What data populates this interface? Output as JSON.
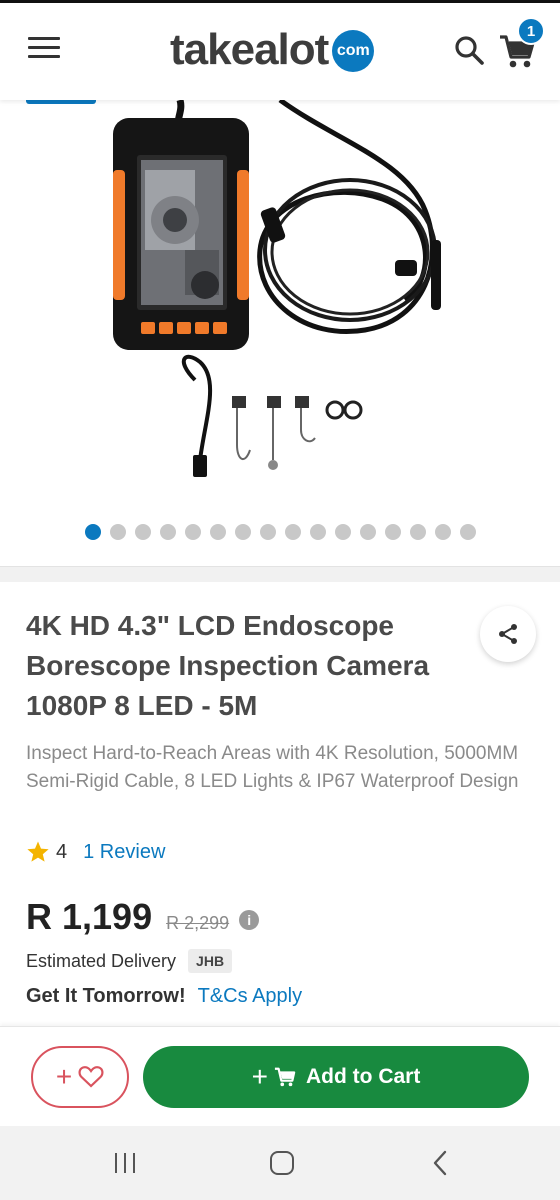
{
  "header": {
    "logo_text": "takealot",
    "logo_badge": ".com",
    "cart_count": "1",
    "icons": [
      "hamburger-menu-icon",
      "search-icon",
      "cart-icon"
    ]
  },
  "gallery": {
    "image_count": 16,
    "active_index": 0
  },
  "product": {
    "title": "4K HD 4.3\" LCD Endoscope Borescope Inspection Camera 1080P 8 LED - 5M",
    "subtitle": "Inspect Hard-to-Reach Areas with 4K Resolution, 5000MM Semi-Rigid Cable, 8 LED Lights & IP67 Waterproof Design",
    "rating": "4",
    "reviews_label": "1 Review",
    "price": "R 1,199",
    "old_price": "R 2,299",
    "delivery_label": "Estimated Delivery",
    "delivery_region": "JHB",
    "delivery_time": "Get It Tomorrow!",
    "terms_link": "T&Cs Apply"
  },
  "actions": {
    "wishlist_label": "+",
    "add_to_cart_label": "Add to Cart"
  },
  "colors": {
    "brand_blue": "#0b79bf",
    "cart_green": "#188a3f",
    "wishlist_red": "#d9535e",
    "star_gold": "#f4b400"
  }
}
